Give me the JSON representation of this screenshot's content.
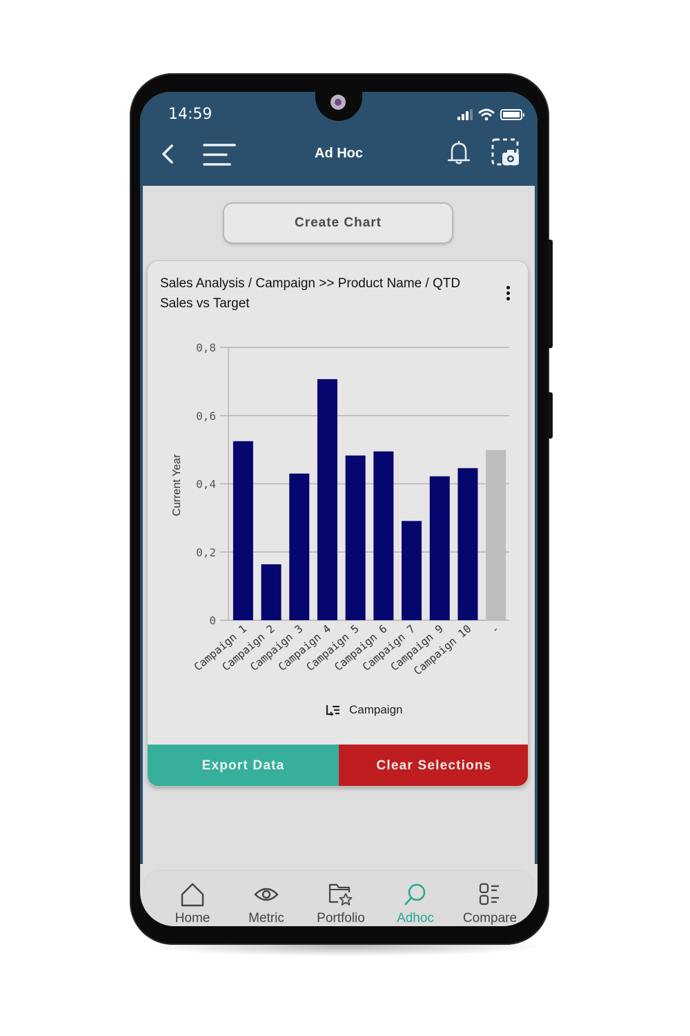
{
  "status_bar": {
    "time": "14:59"
  },
  "header": {
    "title": "Ad Hoc",
    "back_icon": "chevron-left-icon",
    "menu_icon": "hamburger-menu-icon",
    "notification_icon": "bell-icon",
    "screenshot_icon": "screenshot-camera-icon",
    "background_color": "#2b506d"
  },
  "toolbar": {
    "create_chart_label": "Create Chart"
  },
  "card": {
    "title_line1": "Sales Analysis / Campaign >> Product Name / QTD",
    "title_line2": "Sales vs Target",
    "legend_icon": "sort-list-icon",
    "legend_label": "Campaign",
    "export_label": "Export Data",
    "clear_label": "Clear Selections",
    "export_color": "#36b09c",
    "clear_color": "#be1e20"
  },
  "chart_data": {
    "type": "bar",
    "title": "",
    "xlabel": "",
    "ylabel": "Current Year",
    "ylim": [
      0,
      0.8
    ],
    "yticks": [
      0,
      0.2,
      0.4,
      0.6,
      0.8
    ],
    "ytick_labels": [
      "0",
      "0,2",
      "0,4",
      "0,6",
      "0,8"
    ],
    "grid": true,
    "categories": [
      "Campaign 1",
      "Campaign 2",
      "Campaign 3",
      "Campaign 4",
      "Campaign 5",
      "Campaign 6",
      "Campaign 7",
      "Campaign 9",
      "Campaign 10",
      "-"
    ],
    "values": [
      0.525,
      0.164,
      0.43,
      0.707,
      0.483,
      0.495,
      0.291,
      0.422,
      0.446,
      0.499
    ],
    "bar_colors": [
      "#06066e",
      "#06066e",
      "#06066e",
      "#06066e",
      "#06066e",
      "#06066e",
      "#06066e",
      "#06066e",
      "#06066e",
      "#bdbdbd"
    ],
    "legend": "bottom-center"
  },
  "bottom_nav": {
    "items": [
      {
        "label": "Home",
        "icon": "home-icon",
        "active": false
      },
      {
        "label": "Metric",
        "icon": "eye-icon",
        "active": false
      },
      {
        "label": "Portfolio",
        "icon": "folder-star-icon",
        "active": false
      },
      {
        "label": "Adhoc",
        "icon": "search-icon",
        "active": true
      },
      {
        "label": "Compare",
        "icon": "compare-list-icon",
        "active": false
      }
    ],
    "active_color": "#2aa88f"
  }
}
